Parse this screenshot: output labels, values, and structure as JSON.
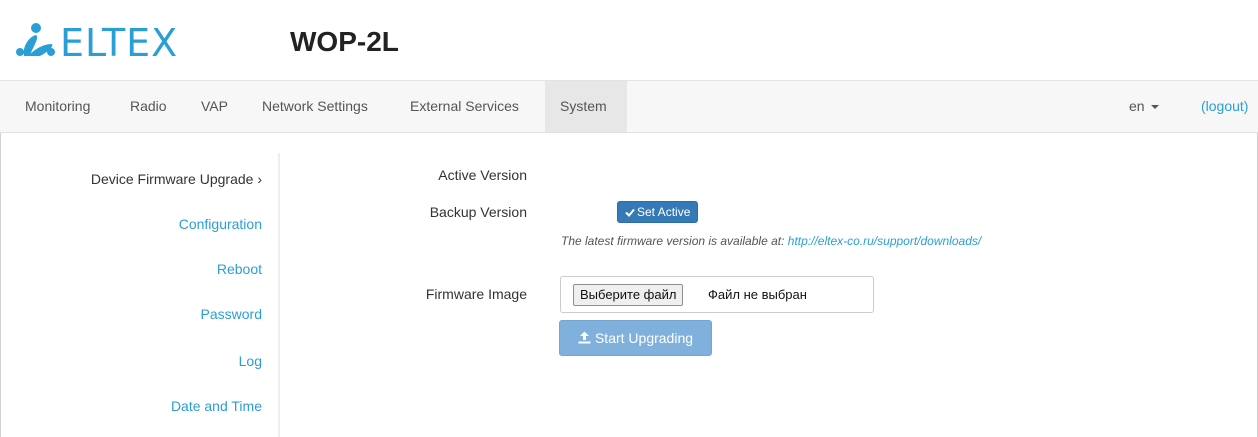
{
  "header": {
    "brand": "ELTEX",
    "model": "WOP-2L",
    "brand_color": "#2a9fd6"
  },
  "nav": {
    "items": [
      {
        "label": "Monitoring"
      },
      {
        "label": "Radio"
      },
      {
        "label": "VAP"
      },
      {
        "label": "Network Settings"
      },
      {
        "label": "External Services"
      },
      {
        "label": "System"
      }
    ],
    "active": "System",
    "language": "en",
    "logout": "(logout)"
  },
  "sidebar": {
    "items": [
      {
        "label": "Device Firmware Upgrade ›"
      },
      {
        "label": "Configuration"
      },
      {
        "label": "Reboot"
      },
      {
        "label": "Password"
      },
      {
        "label": "Log"
      },
      {
        "label": "Date and Time"
      }
    ]
  },
  "content": {
    "active_version_label": "Active Version",
    "backup_version_label": "Backup Version",
    "set_active_button": "Set Active",
    "hint_text": "The latest firmware version is available at: ",
    "hint_link": "http://eltex-co.ru/support/downloads/",
    "firmware_image_label": "Firmware Image",
    "file_button": "Выберите файл",
    "file_status": "Файл не выбран",
    "upgrade_button": "Start Upgrading"
  },
  "icons": {
    "check": "check-icon",
    "upload": "upload-icon",
    "caret": "caret-down-icon"
  }
}
